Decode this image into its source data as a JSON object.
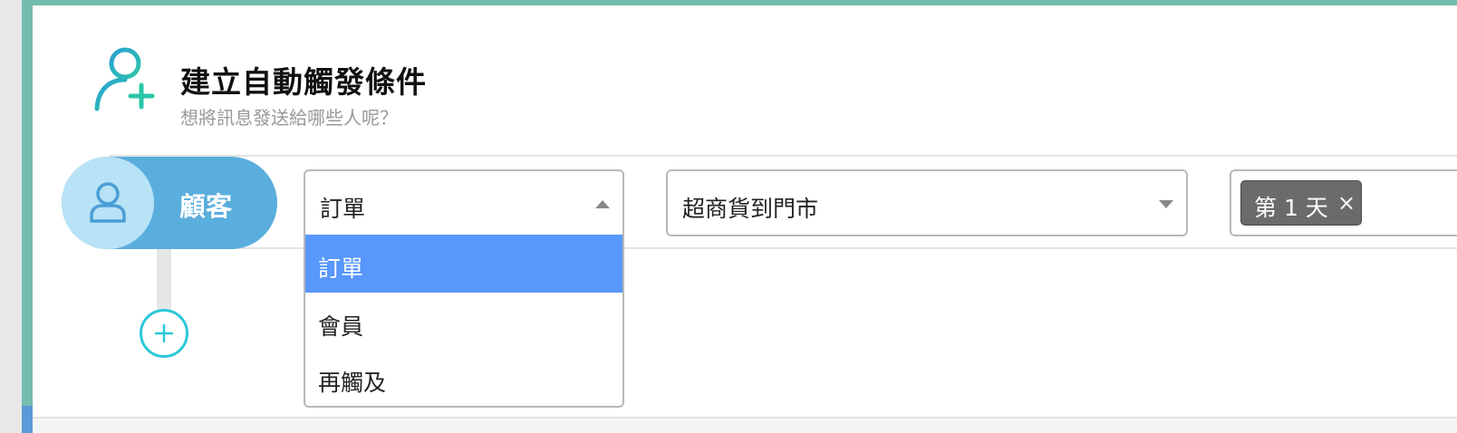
{
  "header": {
    "title": "建立自動觸發條件",
    "subtitle": "想將訊息發送給哪些人呢？",
    "icon": "user-plus-icon"
  },
  "audience": {
    "label": "顧客",
    "icon": "user-icon"
  },
  "conditions": {
    "type_select": {
      "value": "訂單",
      "options": [
        "訂單",
        "會員",
        "再觸及"
      ],
      "highlighted_index": 0
    },
    "subtype_select": {
      "value": "超商貨到門市"
    },
    "day_tags": [
      {
        "label": "第 1 天",
        "remove_label": "×"
      }
    ]
  },
  "colors": {
    "frame": "#74bcad",
    "pill": "#5aaedd",
    "pill_circle": "#b8e3f6",
    "highlight": "#5897fb",
    "add_button": "#2cc8d8",
    "tag": "#6b6b6b"
  }
}
